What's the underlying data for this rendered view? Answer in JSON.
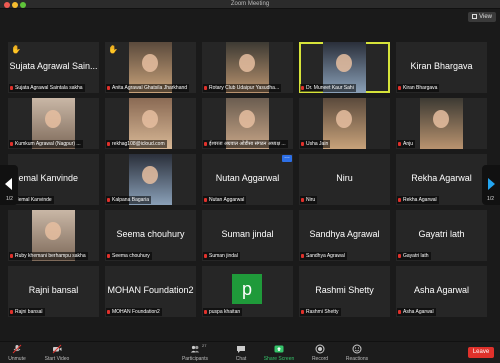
{
  "window": {
    "title": "Zoom Meeting"
  },
  "topbar": {
    "view_label": "View"
  },
  "tiles": [
    {
      "big": "Sujata Agrawal Sain...",
      "label": "Sujata Agrawal Saintala sakha",
      "hand": true,
      "video": false
    },
    {
      "big": "",
      "label": "Anita Agrawal Ghatsila Jharkhand",
      "hand": true,
      "video": true
    },
    {
      "big": "",
      "label": "Rotary Club Udaipur Yasudha...",
      "hand": false,
      "video": true
    },
    {
      "big": "",
      "label": "Dr. Muneet Kaur Sahi",
      "hand": false,
      "video": true,
      "active": true
    },
    {
      "big": "Kiran Bhargava",
      "label": "Kiran Bhargava",
      "hand": false,
      "video": false
    },
    {
      "big": "",
      "label": "Kumkum Agrawal (Nagpur) ...",
      "video": true
    },
    {
      "big": "",
      "label": "rekhag108@icloud.com",
      "video": true
    },
    {
      "big": "",
      "label": "ईश्वरता अग्रवाल ओडीसा संगठन अध्यक्ष ...",
      "video": true
    },
    {
      "big": "",
      "label": "Usha Jain",
      "video": true
    },
    {
      "big": "",
      "label": "Anju",
      "video": true
    },
    {
      "big": "Hemal Kanvinde",
      "label": "Hemal Kanvinde",
      "video": false,
      "left": true
    },
    {
      "big": "",
      "label": "Kalpana Bagaria",
      "video": true
    },
    {
      "big": "Nutan Aggarwal",
      "label": "Nutan Aggarwal",
      "video": false,
      "more": true
    },
    {
      "big": "Niru",
      "label": "Niru",
      "video": false
    },
    {
      "big": "Rekha Agarwal",
      "label": "Rekha Agarwal",
      "video": false
    },
    {
      "big": "",
      "label": "Ruby khemani berhampu sakha",
      "video": true
    },
    {
      "big": "Seema chouhury",
      "label": "Seema chouhury",
      "video": false
    },
    {
      "big": "Suman jindal",
      "label": "Suman jindal",
      "video": false
    },
    {
      "big": "Sandhya Agrawal",
      "label": "Sandhya Agrawal",
      "video": false
    },
    {
      "big": "Gayatri lath",
      "label": "Gayatri lath",
      "video": false
    },
    {
      "big": "Rajni bansal",
      "label": "Rajni bansal",
      "video": false
    },
    {
      "big": "MOHAN Foundation2",
      "label": "MOHAN Foundation2",
      "video": false
    },
    {
      "big": "",
      "label": "puspa khaitan",
      "video": false,
      "avatar": "p"
    },
    {
      "big": "Rashmi Shetty",
      "label": "Rashmi Shetty",
      "video": false
    },
    {
      "big": "Asha Agarwal",
      "label": "Asha Agarwal",
      "video": false
    }
  ],
  "pager": {
    "left": "1/2",
    "right": "1/2"
  },
  "toolbar": {
    "unmute": "Unmute",
    "start_video": "Start Video",
    "participants": "Participants",
    "participants_count": "27",
    "chat": "Chat",
    "share_screen": "Share Screen",
    "record": "Record",
    "reactions": "Reactions",
    "leave": "Leave"
  },
  "colors": {
    "active_border": "#d6e33a",
    "leave": "#e0312b",
    "share": "#35c46a",
    "arrow": "#23a5f0"
  }
}
